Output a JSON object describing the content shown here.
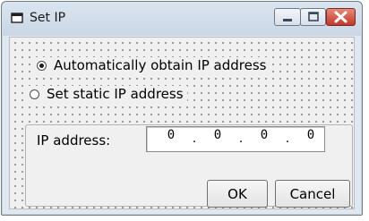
{
  "window": {
    "title": "Set IP",
    "title_icon": "app-window-icon",
    "minimize_icon": "minimize-icon",
    "maximize_icon": "maximize-icon",
    "close_icon": "close-icon"
  },
  "options": {
    "auto_label": "Automatically obtain IP address",
    "auto_selected": true,
    "static_label": "Set static IP address",
    "static_selected": false
  },
  "ip": {
    "label": "IP address:",
    "octets": [
      "0",
      "0",
      "0",
      "0"
    ],
    "separator": "."
  },
  "buttons": {
    "ok_label": "OK",
    "cancel_label": "Cancel"
  },
  "colors": {
    "close_button": "#c2382a",
    "titlebar": "#dbe5f0"
  }
}
